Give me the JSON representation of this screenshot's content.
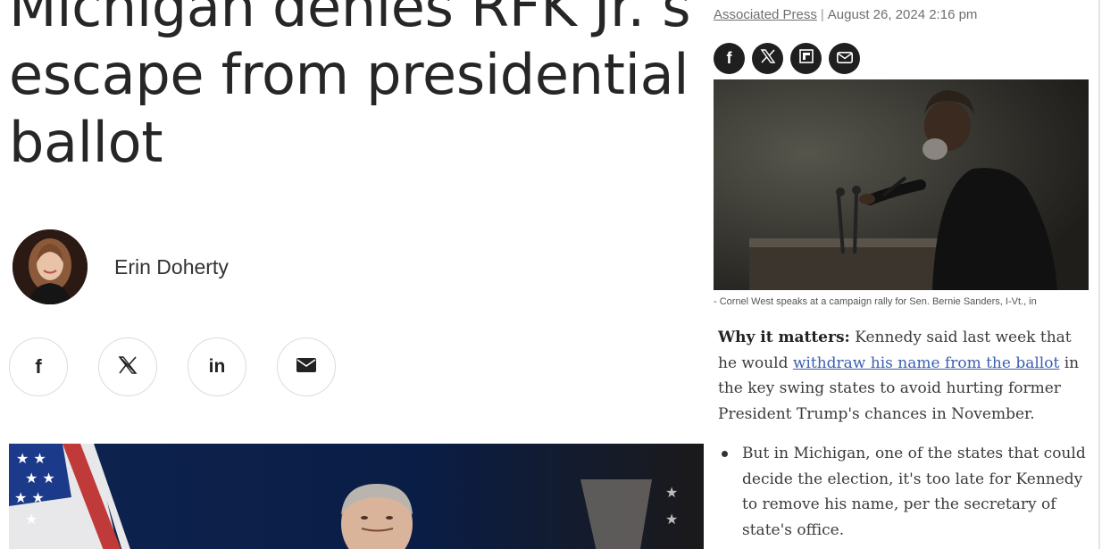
{
  "article": {
    "headline": "Michigan denies RFK Jr.’s\nescape from presidential\nballot",
    "author": {
      "name": "Erin Doherty"
    },
    "share": {
      "facebook": "f",
      "x": "X",
      "linkedin": "in",
      "email": "✉"
    }
  },
  "sidebar": {
    "source": "Associated Press",
    "separator": "|",
    "date": "August 26, 2024 2:16 pm",
    "share": {
      "facebook": "f",
      "x": "X",
      "flipboard": "F",
      "email": "✉"
    },
    "photo_caption": "- Cornel West speaks at a campaign rally for Sen. Bernie Sanders, I-Vt., in",
    "lead_label": "Why it matters:",
    "lead_text_1": "Kennedy said last week that he would",
    "lead_link": "withdraw his name from the ballot",
    "lead_text_2": "in the key swing states to avoid hurting former President Trump's chances in November.",
    "bullet_1": "But in Michigan, one of the states that could decide the election, it's too late for Kennedy to remove his name, per the secretary of state's office."
  },
  "colors": {
    "link": "#3b5fb0",
    "text": "#262626",
    "share_dark": "#1f1f1f"
  }
}
